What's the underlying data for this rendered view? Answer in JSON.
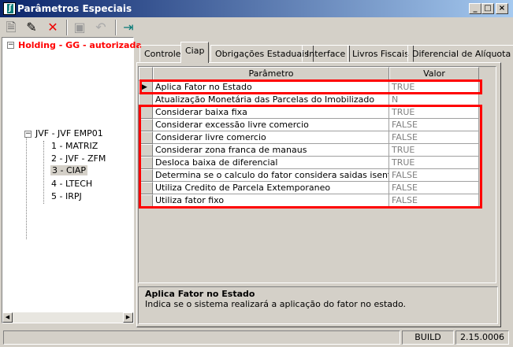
{
  "window": {
    "title": "Parâmetros Especiais",
    "minimize": "_",
    "maximize": "□",
    "close": "×"
  },
  "toolbar": {
    "new": "new-document-icon",
    "edit": "edit-icon",
    "delete": "delete-icon",
    "save": "save-icon",
    "undo": "undo-icon",
    "exit": "exit-door-icon"
  },
  "tree": {
    "root": "Holding -  GG -  autorizada",
    "company": "JVF - JVF  EMP01",
    "items": [
      "1 - MATRIZ",
      "2 - JVF - ZFM",
      "3 - CIAP",
      "4 - LTECH",
      "5 - IRPJ"
    ],
    "selected": "3 - CIAP",
    "expand": "−"
  },
  "tabs": [
    "Controle",
    "Ciap",
    "Obrigações Estaduais",
    "Interface",
    "Livros Fiscais",
    "Diferencial de Alíquota"
  ],
  "active_tab": "Ciap",
  "grid": {
    "headers": [
      "Parâmetro",
      "Valor"
    ],
    "current_row_marker": "▶",
    "rows": [
      {
        "param": "Aplica Fator no Estado",
        "value": "TRUE"
      },
      {
        "param": "Atualização Monetária das Parcelas do Imobilizado",
        "value": "N"
      },
      {
        "param": "Considerar baixa fixa",
        "value": "TRUE"
      },
      {
        "param": "Considerar excessão livre comercio",
        "value": "FALSE"
      },
      {
        "param": "Considerar livre comercio",
        "value": "FALSE"
      },
      {
        "param": "Considerar zona franca de manaus",
        "value": "TRUE"
      },
      {
        "param": "Desloca baixa de diferencial",
        "value": "TRUE"
      },
      {
        "param": "Determina se o calculo do fator considera saidas isentas.",
        "value": "FALSE"
      },
      {
        "param": "Utiliza Credito de Parcela Extemporaneo",
        "value": "FALSE"
      },
      {
        "param": "Utiliza fator fixo",
        "value": "FALSE"
      }
    ]
  },
  "description": {
    "title": "Aplica Fator no Estado",
    "text": "Indica se o sistema realizará a aplicação do fator no estado."
  },
  "status": {
    "build_label": "BUILD",
    "version": "2.15.0006"
  },
  "colors": {
    "highlight": "#ff0000",
    "tree_root": "#ff0000"
  }
}
